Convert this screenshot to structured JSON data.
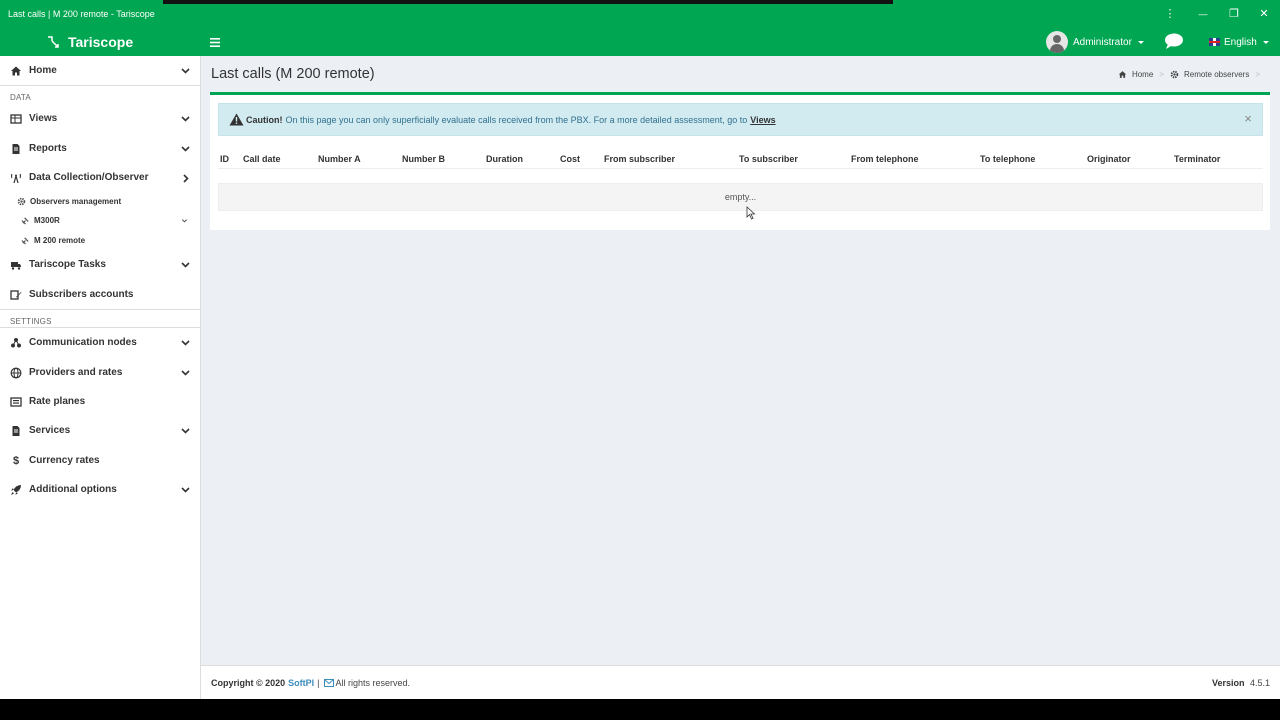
{
  "window": {
    "title": "Last calls | M 200 remote - Tariscope",
    "buttons": {
      "menu": "⋮",
      "minimize": "—",
      "restore": "❐",
      "close": "✕"
    }
  },
  "header": {
    "brand": "Tariscope",
    "user": "Administrator",
    "language": "English",
    "accent_color": "#00a651"
  },
  "sidebar": {
    "home": "Home",
    "section_data": "DATA",
    "views": "Views",
    "reports": "Reports",
    "data_collection": "Data Collection/Observer",
    "observers_management": "Observers management",
    "m300r": "M300R",
    "m200_remote": "M 200 remote",
    "tariscope_tasks": "Tariscope Tasks",
    "subscribers_accounts": "Subscribers accounts",
    "section_settings": "SETTINGS",
    "communication_nodes": "Communication nodes",
    "providers_and_rates": "Providers and rates",
    "rate_planes": "Rate planes",
    "services": "Services",
    "currency_rates": "Currency rates",
    "additional_options": "Additional options"
  },
  "page": {
    "title": "Last calls (M 200 remote)",
    "breadcrumb": [
      "Home",
      "Remote observers"
    ]
  },
  "alert": {
    "label": "Caution!",
    "text": "On this page you can only superficially evaluate calls received from the PBX. For a more detailed assessment, go to",
    "link": "Views",
    "close": "×"
  },
  "table": {
    "columns": [
      "ID",
      "Call date",
      "Number A",
      "Number B",
      "Duration",
      "Cost",
      "From subscriber",
      "To subscriber",
      "From telephone",
      "To telephone",
      "Originator",
      "Terminator"
    ],
    "empty_text": "empty..."
  },
  "footer": {
    "copyright": "Copyright © 2020",
    "company": "SoftPI",
    "separator": "|",
    "rights": "All rights reserved.",
    "version_label": "Version",
    "version": "4.5.1"
  }
}
